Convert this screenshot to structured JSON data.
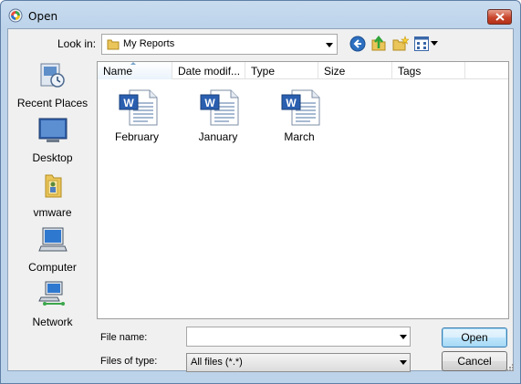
{
  "window": {
    "title": "Open",
    "close_icon": "close-icon"
  },
  "toolbar": {
    "lookin_label": "Look in:",
    "lookin_value": "My Reports",
    "icons": [
      "back-icon",
      "up-folder-icon",
      "new-folder-icon",
      "views-icon"
    ]
  },
  "places": [
    {
      "label": "Recent Places",
      "icon": "recent-places-icon"
    },
    {
      "label": "Desktop",
      "icon": "desktop-icon"
    },
    {
      "label": "vmware",
      "icon": "user-folder-icon"
    },
    {
      "label": "Computer",
      "icon": "computer-icon"
    },
    {
      "label": "Network",
      "icon": "network-icon"
    }
  ],
  "columns": [
    "Name",
    "Date modif...",
    "Type",
    "Size",
    "Tags"
  ],
  "files": [
    {
      "name": "February",
      "icon": "word-document-icon"
    },
    {
      "name": "January",
      "icon": "word-document-icon"
    },
    {
      "name": "March",
      "icon": "word-document-icon"
    }
  ],
  "bottom": {
    "filename_label": "File name:",
    "filename_value": "",
    "filetype_label": "Files of type:",
    "filetype_value": "All files (*.*)",
    "open_label": "Open",
    "cancel_label": "Cancel"
  },
  "colors": {
    "accent": "#3c7fb1",
    "titlebar": "#c9dcef",
    "close": "#c9452c"
  }
}
